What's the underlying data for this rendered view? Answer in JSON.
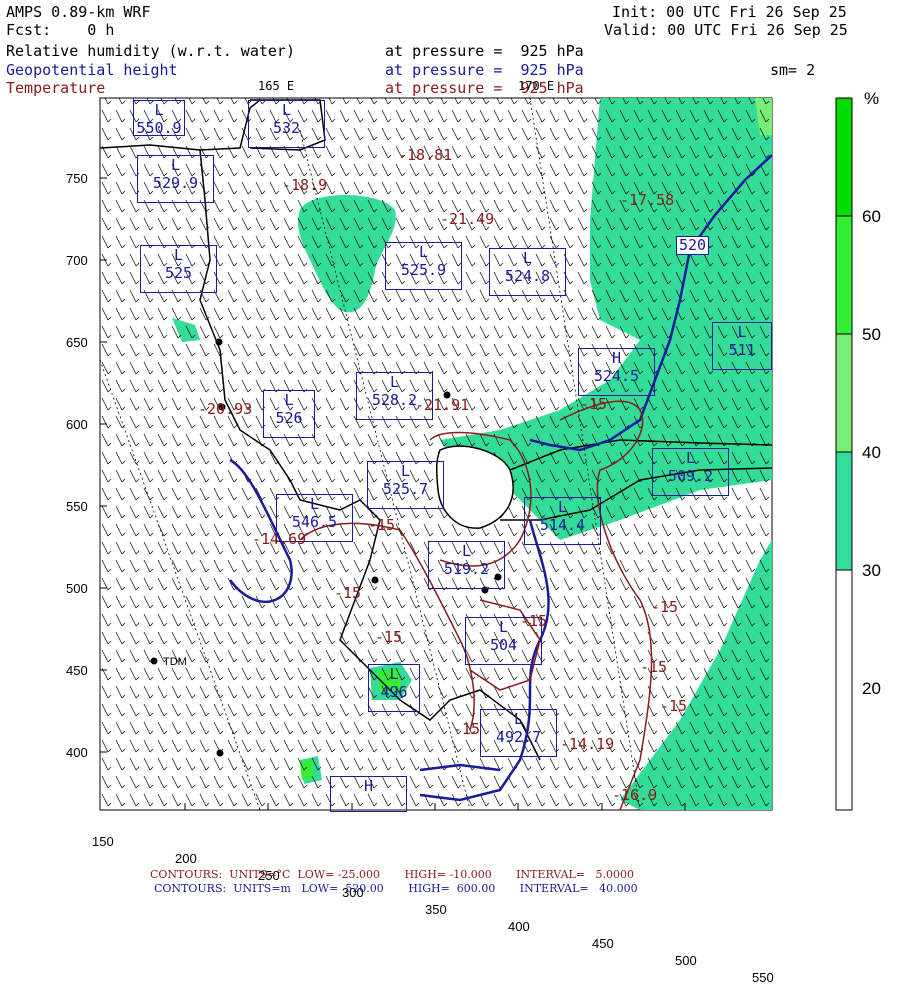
{
  "header": {
    "model": "AMPS 0.89-km WRF",
    "fcst": "Fcst:    0 h",
    "init": "Init: 00 UTC Fri 26 Sep 25",
    "valid": "Valid: 00 UTC Fri 26 Sep 25",
    "field1": "Relative humidity (w.r.t. water)",
    "field2": "Geopotential height",
    "field3": "Temperature",
    "level1": "at pressure =  925 hPa",
    "level2": "at pressure =  925 hPa",
    "level3": "at pressure =  925 hPa",
    "smooth": "sm= 2",
    "lon_label_left": "165 E",
    "lon_label_right": "170 E"
  },
  "colorbar": {
    "unit": "%",
    "ticks": [
      "60",
      "50",
      "40",
      "30",
      "20"
    ],
    "colors": [
      "#00dd00",
      "#33ee33",
      "#77ee77",
      "#33dd99",
      "#ffffff"
    ]
  },
  "axes": {
    "x_ticks": [
      "150",
      "200",
      "250",
      "300",
      "350",
      "400",
      "450",
      "500",
      "550"
    ],
    "y_ticks": [
      "750",
      "700",
      "650",
      "600",
      "550",
      "500",
      "450",
      "400"
    ]
  },
  "lows": [
    {
      "label": "L",
      "value": "550.9"
    },
    {
      "label": "L",
      "value": "532"
    },
    {
      "label": "L",
      "value": "529.9"
    },
    {
      "label": "L",
      "value": "525"
    },
    {
      "label": "L",
      "value": "525.9"
    },
    {
      "label": "L",
      "value": "524.8"
    },
    {
      "label": "L",
      "value": "520"
    },
    {
      "label": "L",
      "value": "526"
    },
    {
      "label": "L",
      "value": "528.2"
    },
    {
      "label": "H",
      "value": "524.5"
    },
    {
      "label": "L",
      "value": "511"
    },
    {
      "label": "L",
      "value": "525.7"
    },
    {
      "label": "L",
      "value": "509.2"
    },
    {
      "label": "L",
      "value": "546.5"
    },
    {
      "label": "L",
      "value": "514.4"
    },
    {
      "label": "L",
      "value": "519.2"
    },
    {
      "label": "L",
      "value": "504"
    },
    {
      "label": "L",
      "value": "496"
    },
    {
      "label": "L",
      "value": "492.7"
    },
    {
      "label": "H",
      "value": ""
    }
  ],
  "height_contours": [
    "520"
  ],
  "temps": [
    "-18.81",
    "-18.9",
    "-17.58",
    "-21.49",
    "-20.93",
    "-21.91",
    "-15",
    "-14.69",
    "-15",
    "-15",
    "-15",
    "-15",
    "-15",
    "-15",
    "-15",
    "-14.19",
    "-15",
    "-16.9"
  ],
  "station": "TDM",
  "footer": {
    "line1": "CONTOURS:  UNITS=°C  LOW= -25.000       HIGH= -10.000       INTERVAL=   5.0000",
    "line2": "CONTOURS:  UNITS=m   LOW=  520.00       HIGH=  600.00       INTERVAL=   40.000"
  }
}
